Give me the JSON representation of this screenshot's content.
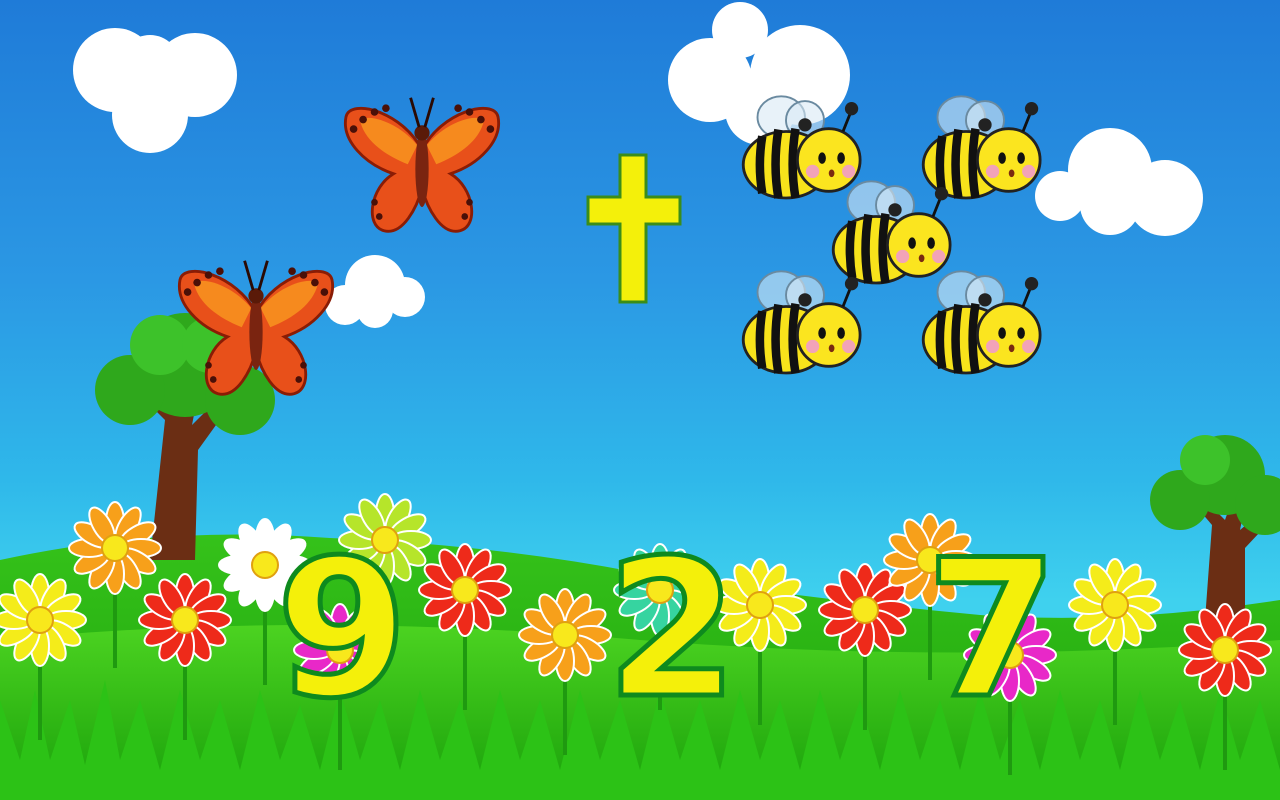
{
  "game": {
    "operator": "+",
    "left_group": {
      "item": "butterfly-icon",
      "count": 2
    },
    "right_group": {
      "item": "bee-icon",
      "count": 5
    },
    "answer_options": [
      "9",
      "2",
      "7"
    ]
  },
  "colors": {
    "sky_top": "#1f7bd8",
    "sky_bottom": "#3fd1ee",
    "grass": "#22b50f",
    "digit_fill": "#f4f00a",
    "digit_outline": "#0e8a1e",
    "plus": "#f4f00a"
  }
}
